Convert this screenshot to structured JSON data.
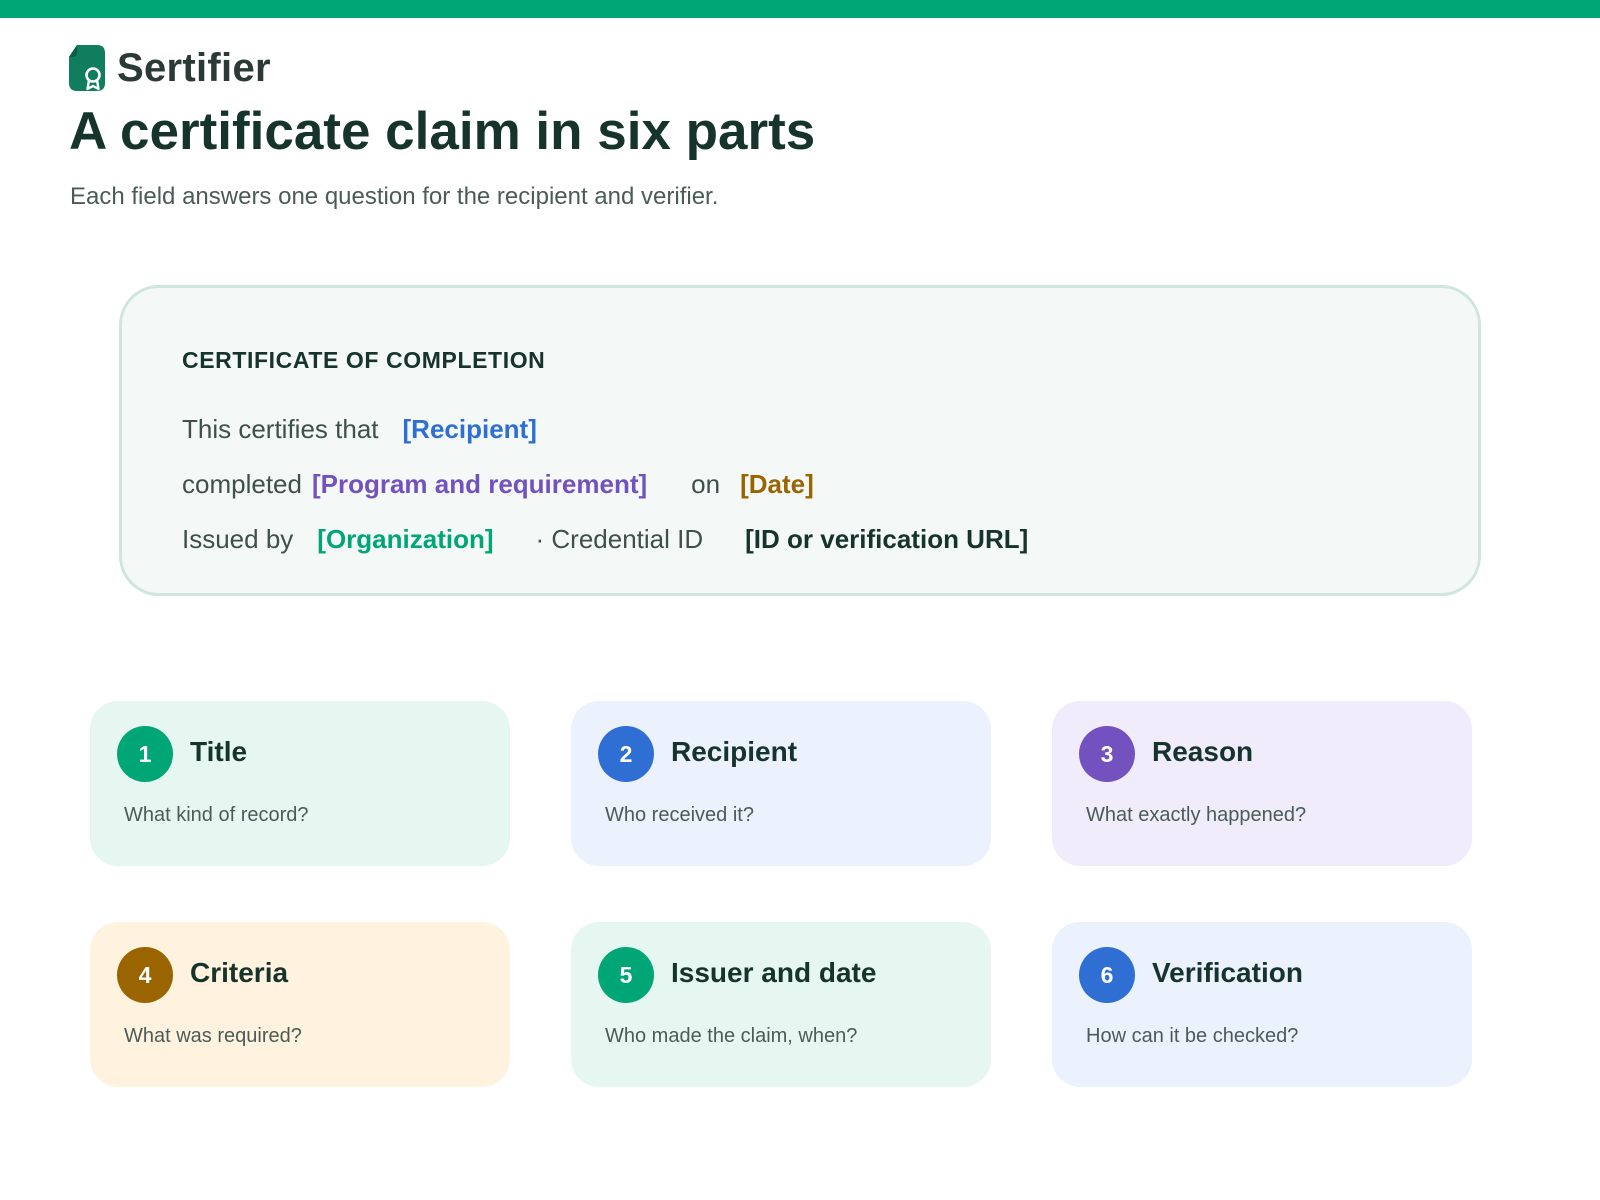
{
  "colors": {
    "brand_green": "#00a676",
    "recipient_blue": "#2f6fd4",
    "reason_purple": "#7352bf",
    "criteria_brown": "#9a6500",
    "dark_text": "#16332c"
  },
  "brand": {
    "name": "Sertifier",
    "icon": "certificate-ribbon-icon"
  },
  "header": {
    "title": "A certificate claim in six parts",
    "subtitle": "Each field answers one question for the recipient and verifier."
  },
  "certificate": {
    "heading": "CERTIFICATE OF COMPLETION",
    "line1": {
      "text": "This certifies that",
      "recipient": "[Recipient]"
    },
    "line2": {
      "text": "completed",
      "program": "[Program and requirement]",
      "on": "on",
      "date": "[Date]"
    },
    "line3": {
      "text": "Issued by",
      "organization": "[Organization]",
      "credential_label": "· Credential ID",
      "credential_value": "[ID or verification URL]"
    }
  },
  "fields": [
    {
      "number": "1",
      "title": "Title",
      "question": "What kind of record?"
    },
    {
      "number": "2",
      "title": "Recipient",
      "question": "Who received it?"
    },
    {
      "number": "3",
      "title": "Reason",
      "question": "What exactly happened?"
    },
    {
      "number": "4",
      "title": "Criteria",
      "question": "What was required?"
    },
    {
      "number": "5",
      "title": "Issuer and date",
      "question": "Who made the claim, when?"
    },
    {
      "number": "6",
      "title": "Verification",
      "question": "How can it be checked?"
    }
  ]
}
